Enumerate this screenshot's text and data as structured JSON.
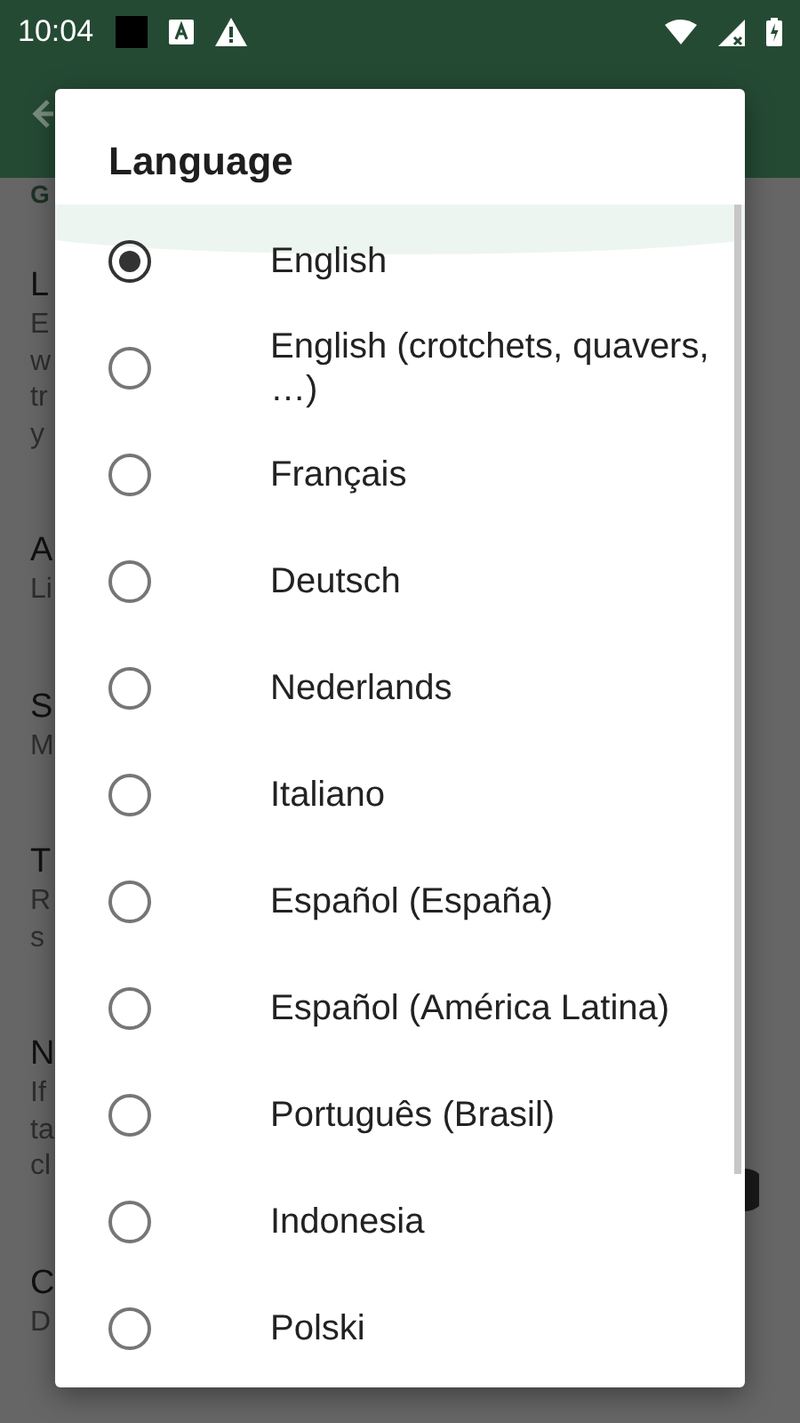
{
  "status_bar": {
    "time": "10:04"
  },
  "settings": {
    "category": "G",
    "items": [
      {
        "title": "L",
        "summary": [
          "E",
          "w",
          "tr",
          "y"
        ]
      },
      {
        "title": "A",
        "summary": [
          "Li"
        ]
      },
      {
        "title": "S",
        "summary": [
          "M"
        ]
      },
      {
        "title": "T",
        "summary": [
          "R",
          "s"
        ]
      },
      {
        "title": "N",
        "summary": [
          "If",
          "ta",
          "cl"
        ]
      },
      {
        "title": "C",
        "summary": [
          "D"
        ]
      }
    ]
  },
  "dialog": {
    "title": "Language",
    "options": [
      {
        "label": "English",
        "selected": true
      },
      {
        "label": "English (crotchets, quavers, …)",
        "selected": false
      },
      {
        "label": "Français",
        "selected": false
      },
      {
        "label": "Deutsch",
        "selected": false
      },
      {
        "label": "Nederlands",
        "selected": false
      },
      {
        "label": "Italiano",
        "selected": false
      },
      {
        "label": "Español (España)",
        "selected": false
      },
      {
        "label": "Español (América Latina)",
        "selected": false
      },
      {
        "label": "Português (Brasil)",
        "selected": false
      },
      {
        "label": "Indonesia",
        "selected": false
      },
      {
        "label": "Polski",
        "selected": false
      }
    ]
  }
}
